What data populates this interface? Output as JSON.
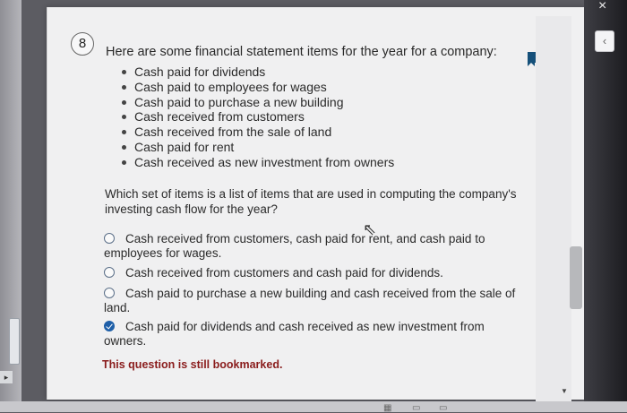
{
  "question": {
    "number": "8",
    "prompt": "Here are some financial statement items for the year for a company:",
    "items": [
      "Cash paid for dividends",
      "Cash paid to employees for wages",
      "Cash paid to purchase a new building",
      "Cash received from customers",
      "Cash received from the sale of land",
      "Cash paid for rent",
      "Cash received as new investment from owners"
    ],
    "text": "Which set of items is a list of items that are used in computing the company's investing cash flow for the year?",
    "options": [
      {
        "label": "Cash received from customers, cash paid for rent, and cash paid to employees for wages.",
        "selected": false
      },
      {
        "label": "Cash received from customers and cash paid for dividends.",
        "selected": false
      },
      {
        "label": "Cash paid to purchase a new building and cash received from the sale of land.",
        "selected": false
      },
      {
        "label": "Cash paid for dividends and cash received as new investment from owners.",
        "selected": true
      }
    ],
    "bookmark_status": "This question is still bookmarked."
  },
  "window": {
    "close_glyph": "×",
    "collapse_glyph": "‹"
  },
  "colors": {
    "bookmark": "#15507a",
    "selected_radio": "#1e5fa8",
    "status_text": "#8a1c1c"
  }
}
